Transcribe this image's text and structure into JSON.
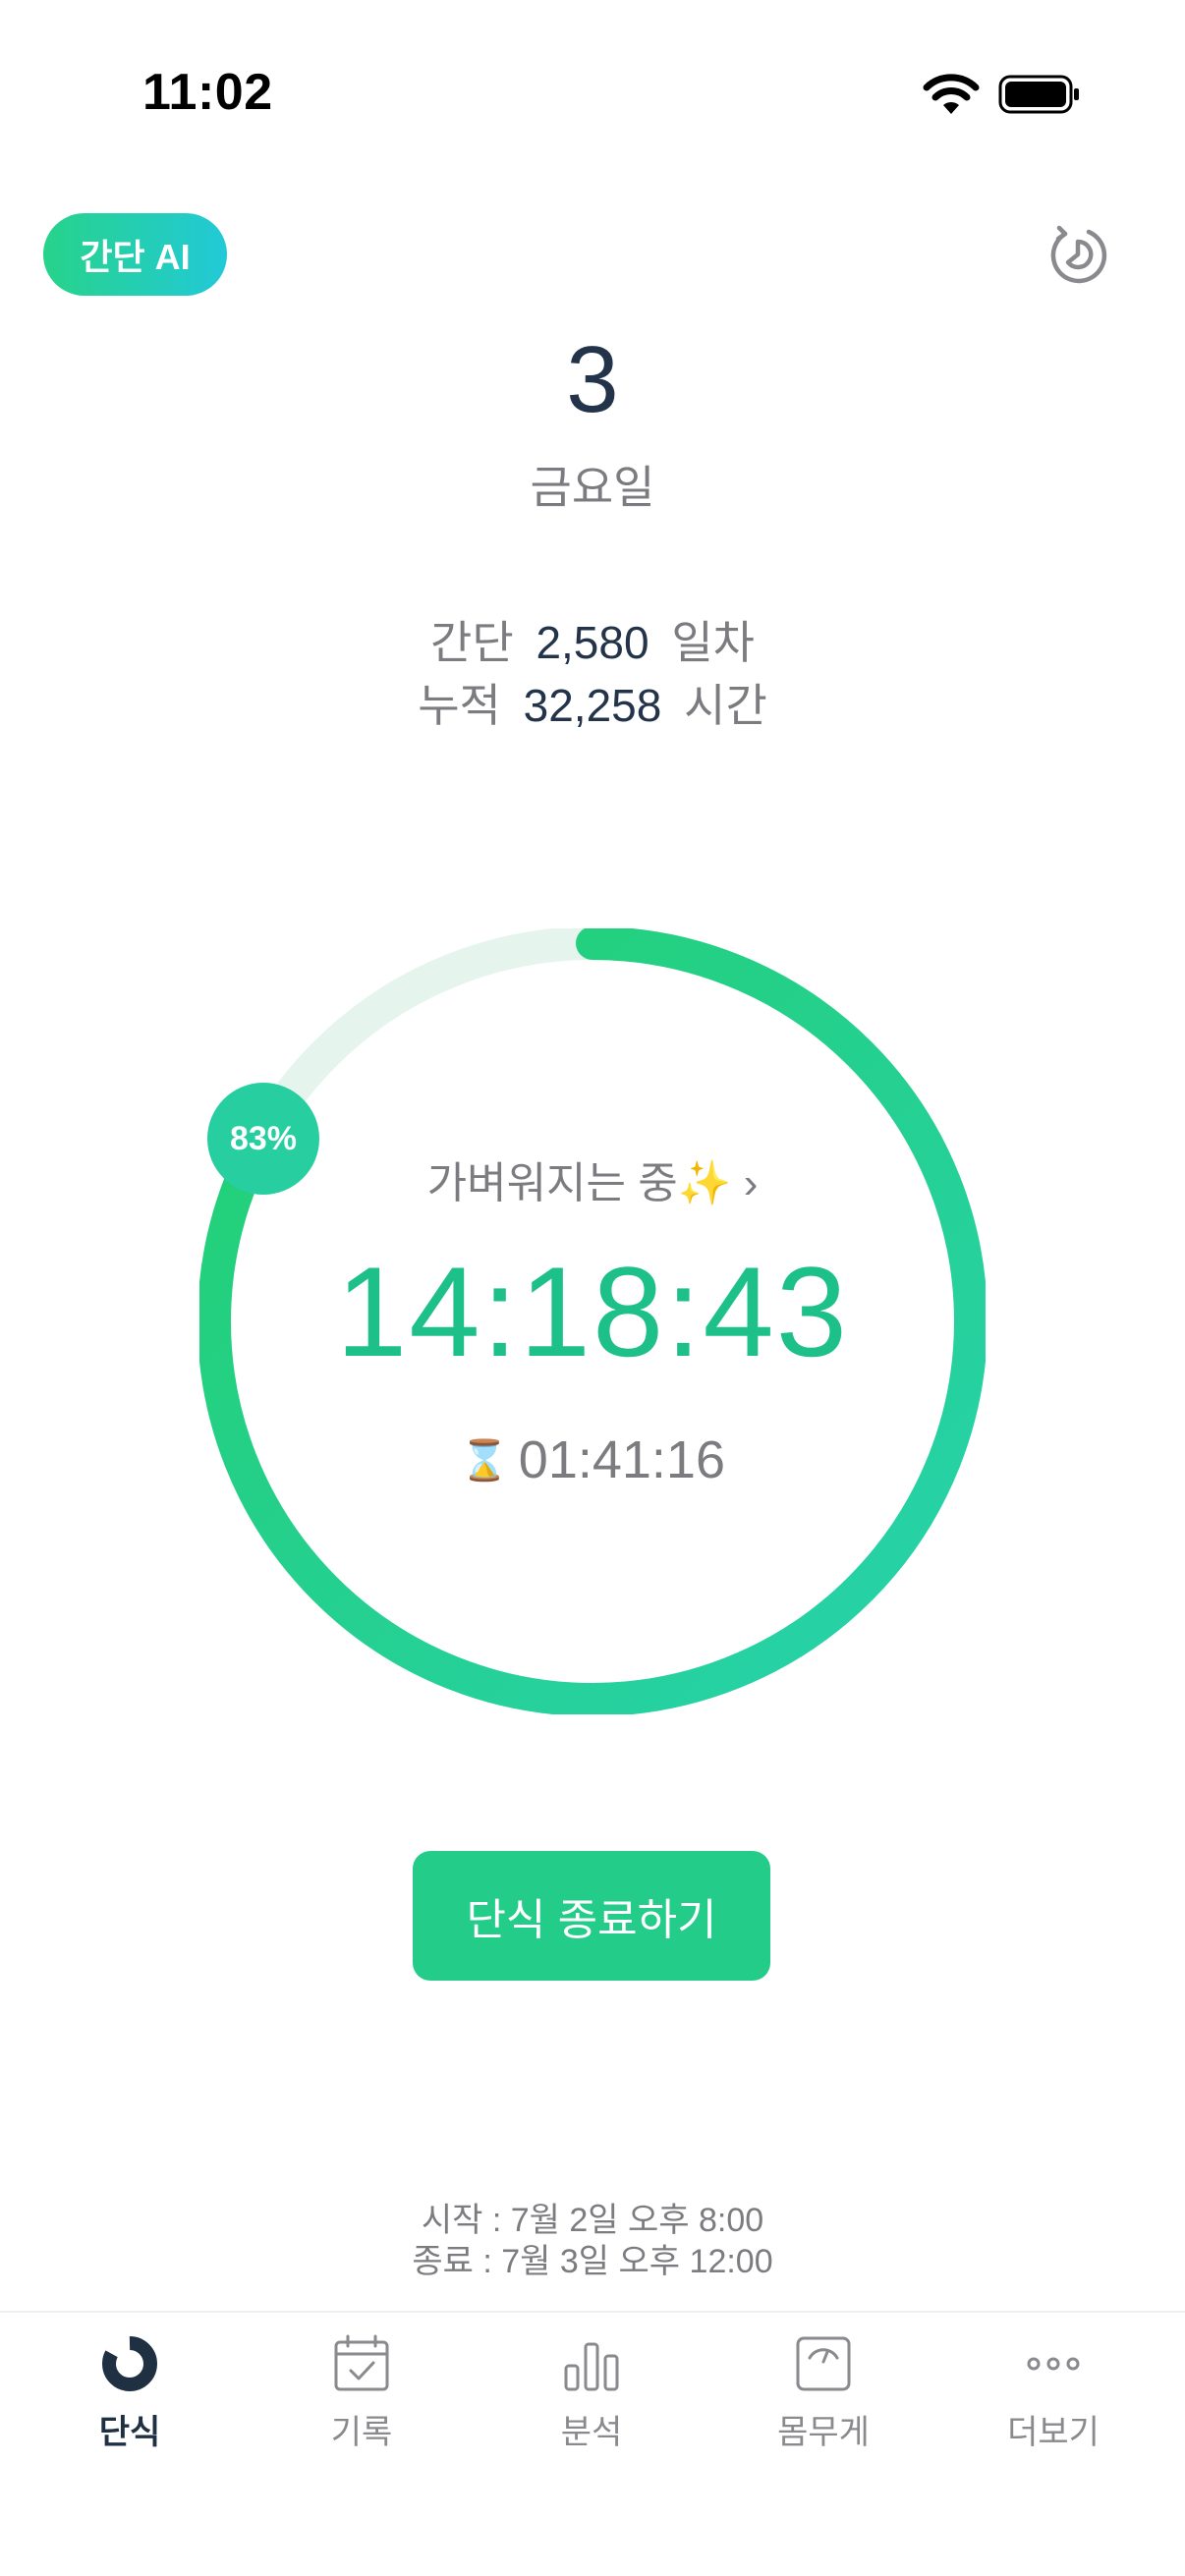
{
  "status_bar": {
    "time": "11:02"
  },
  "header": {
    "ai_badge": "간단 AI"
  },
  "date": {
    "day": "3",
    "weekday": "금요일"
  },
  "stats": {
    "streak_label": "간단",
    "streak_value": "2,580",
    "streak_unit": "일차",
    "total_label": "누적",
    "total_value": "32,258",
    "total_unit": "시간"
  },
  "timer": {
    "progress_percent": 83,
    "progress_label": "83%",
    "status": "가벼워지는 중✨ ›",
    "elapsed": "14:18:43",
    "remaining_icon": "⌛",
    "remaining": "01:41:16"
  },
  "colors": {
    "accent": "#24cc8a",
    "accent_teal": "#27cfa0",
    "track": "#e5f5ee"
  },
  "actions": {
    "end_fast": "단식 종료하기"
  },
  "schedule": {
    "start": "시작 : 7월 2일 오후 8:00",
    "end": "종료 : 7월 3일 오후 12:00"
  },
  "tabs": [
    {
      "label": "단식",
      "icon": "fasting-ring-icon",
      "active": true
    },
    {
      "label": "기록",
      "icon": "calendar-check-icon",
      "active": false
    },
    {
      "label": "분석",
      "icon": "bar-chart-icon",
      "active": false
    },
    {
      "label": "몸무게",
      "icon": "scale-icon",
      "active": false
    },
    {
      "label": "더보기",
      "icon": "more-dots-icon",
      "active": false
    }
  ]
}
